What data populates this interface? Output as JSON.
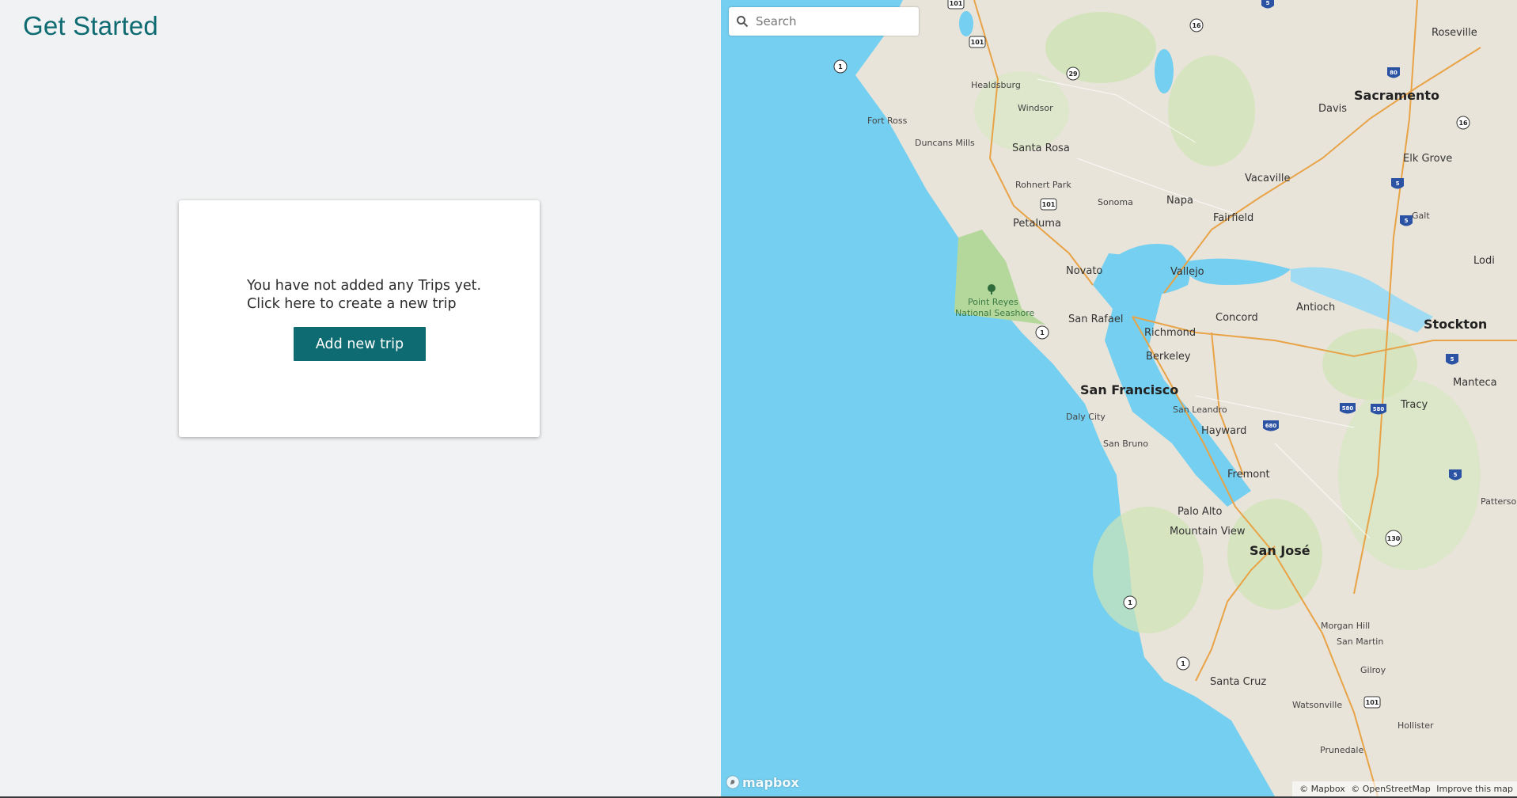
{
  "header": {
    "title": "Get Started"
  },
  "empty_state": {
    "line1": "You have not added any Trips yet.",
    "line2": "Click here to create a new trip",
    "button_label": "Add new trip"
  },
  "map": {
    "search": {
      "placeholder": "Search"
    },
    "logo_text": "mapbox",
    "attribution": {
      "copyright_mapbox": "© Mapbox",
      "copyright_osm": "© OpenStreetMap",
      "improve": "Improve this map"
    },
    "cities_major": [
      "Sacramento",
      "San Francisco",
      "San José",
      "Stockton"
    ],
    "cities_mid": [
      "Santa Rosa",
      "Vallejo",
      "Berkeley",
      "Concord",
      "Fremont",
      "Hayward",
      "Richmond",
      "Antioch",
      "Elk Grove",
      "Davis",
      "Vacaville",
      "Fairfield",
      "Napa",
      "Petaluma",
      "Novato",
      "San Rafael",
      "Palo Alto",
      "Mountain View",
      "Santa Cruz",
      "Roseville",
      "Lodi",
      "Tracy",
      "Manteca"
    ],
    "cities_small": [
      "Healdsburg",
      "Windsor",
      "Fort Ross",
      "Duncans Mills",
      "Rohnert Park",
      "Sonoma",
      "Daly City",
      "San Bruno",
      "San Leandro",
      "Morgan Hill",
      "San Martin",
      "Gilroy",
      "Watsonville",
      "Prunedale",
      "Hollister",
      "Galt",
      "Patterson"
    ],
    "parks": [
      "Point Reyes",
      "National Seashore"
    ],
    "route_shields": [
      "101",
      "1",
      "29",
      "16",
      "80",
      "5",
      "680",
      "580",
      "130"
    ],
    "colors": {
      "water": "#75cff0",
      "land": "#e9e4da",
      "park": "#c2dfa5",
      "highway": "#e8a347",
      "accent": "#0e6b72"
    }
  }
}
